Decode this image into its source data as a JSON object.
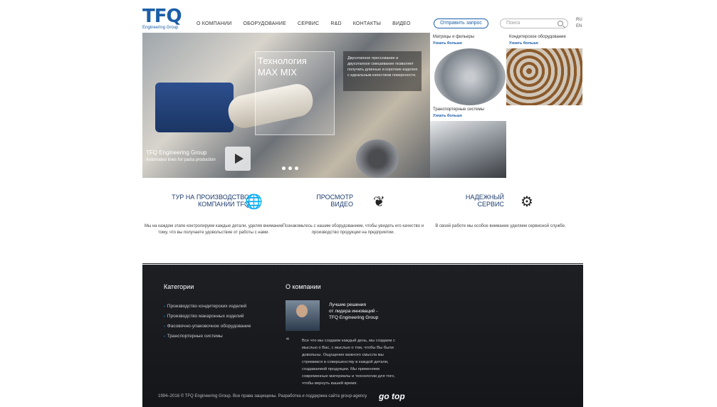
{
  "brand": {
    "logo_text": "TFQ",
    "logo_sub": "Engineering Group"
  },
  "nav": [
    "О компании",
    "Оборудование",
    "Сервис",
    "R&D",
    "Контакты",
    "Видео"
  ],
  "header": {
    "request_button": "Отправить запрос",
    "search_placeholder": "Поиск",
    "lang_ru": "RU",
    "lang_en": "EN"
  },
  "hero": {
    "title_line1": "Технология",
    "title_line2": "MAX MIX",
    "description": "Двухэтапное прессование и двухэтапное смешивание позволяет получать длинные и короткие изделия с идеальным качеством поверхности.",
    "caption": "TFQ Engineering Group",
    "subcaption": "Automated lines for pasta production"
  },
  "tiles": [
    {
      "title": "Матрицы и фильеры",
      "link": "Узнать больше"
    },
    {
      "title": "Кондитерское оборудование",
      "link": "Узнать больше"
    },
    {
      "title": "Транспортерные системы",
      "link": "Узнать больше"
    }
  ],
  "features": [
    {
      "title_line1": "Тур на производство",
      "title_line2": "компании TFQ",
      "icon": "globe-icon",
      "text": "Мы на каждом этапе контролируем каждые детали, уделяя внимание тому, что вы получаете удовольствие от работы с нами."
    },
    {
      "title_line1": "Просмотр",
      "title_line2": "видео",
      "icon": "leaf-icon",
      "text": "Познакомьтесь с нашим оборудованием, чтобы увидеть его качество и производство продукции на предприятии."
    },
    {
      "title_line1": "Надежный",
      "title_line2": "сервис",
      "icon": "gears-icon",
      "text": "В своей работе мы особое внимание уделяем сервисной службе."
    }
  ],
  "footer": {
    "categories_heading": "Категории",
    "categories": [
      "Производство кондитерских изделий",
      "Производство макаронных изделий",
      "Фасовочно-упаковочное оборудование",
      "Транспортерные системы"
    ],
    "about_heading": "О компании",
    "quote_heading_line1": "Лучшие решения",
    "quote_heading_line2": "от лидера инноваций -",
    "quote_heading_line3": "TFQ Engineering Group",
    "quote_mark": "“",
    "quote_text": "Все что мы создаем каждый день, мы создаем с мыслью о Вас, с мыслью о том, чтобы Вы были довольны. Ощущение важного смысла мы стремимся в совершенству в каждой детали, создаваемой продукции. Мы применяем современные материалы и технологии для того, чтобы вернуть вашей время.",
    "copyright": "1994–2016 © TFQ Engineering Group. Все права защищены. Разработка и поддержка сайта group-agency",
    "gotop": "go top"
  },
  "colors": {
    "brand_blue": "#1b5ea8",
    "footer_bg": "#1d1f23"
  }
}
